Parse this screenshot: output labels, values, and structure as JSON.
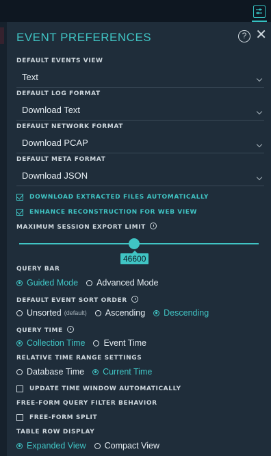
{
  "colors": {
    "accent": "#40c4c4",
    "panel_bg": "#1f2d3a",
    "page_bg": "#0f1a24",
    "text": "#e6edf2"
  },
  "header": {
    "title": "EVENT PREFERENCES",
    "help_label": "?",
    "close_label": "✕"
  },
  "defaults": [
    {
      "label": "DEFAULT EVENTS VIEW",
      "value": "Text"
    },
    {
      "label": "DEFAULT LOG FORMAT",
      "value": "Download Text"
    },
    {
      "label": "DEFAULT NETWORK FORMAT",
      "value": "Download PCAP"
    },
    {
      "label": "DEFAULT META FORMAT",
      "value": "Download JSON"
    }
  ],
  "checks": {
    "download_extracted": {
      "label": "DOWNLOAD EXTRACTED FILES AUTOMATICALLY",
      "checked": true
    },
    "enhance_reconstruction": {
      "label": "ENHANCE RECONSTRUCTION FOR WEB VIEW",
      "checked": true
    },
    "update_time_window": {
      "label": "UPDATE TIME WINDOW AUTOMATICALLY",
      "checked": false
    },
    "free_form_split": {
      "label": "FREE-FORM SPLIT",
      "checked": false
    }
  },
  "session_limit": {
    "label": "MAXIMUM SESSION EXPORT LIMIT",
    "value": "46600",
    "fraction": 0.48
  },
  "query_bar": {
    "label": "QUERY BAR",
    "options": [
      "Guided Mode",
      "Advanced Mode"
    ],
    "selected": "Guided Mode"
  },
  "sort_order": {
    "label": "DEFAULT EVENT SORT ORDER",
    "options": [
      "Unsorted",
      "Ascending",
      "Descending"
    ],
    "unsorted_note": "(default)",
    "selected": "Descending"
  },
  "query_time": {
    "label": "QUERY TIME",
    "options": [
      "Collection Time",
      "Event Time"
    ],
    "selected": "Collection Time"
  },
  "relative_time": {
    "label": "RELATIVE TIME RANGE SETTINGS",
    "options": [
      "Database Time",
      "Current Time"
    ],
    "selected": "Current Time"
  },
  "free_form": {
    "label": "FREE-FORM QUERY FILTER BEHAVIOR"
  },
  "row_display": {
    "label": "TABLE ROW DISPLAY",
    "options": [
      "Expanded View",
      "Compact View"
    ],
    "selected": "Expanded View"
  }
}
